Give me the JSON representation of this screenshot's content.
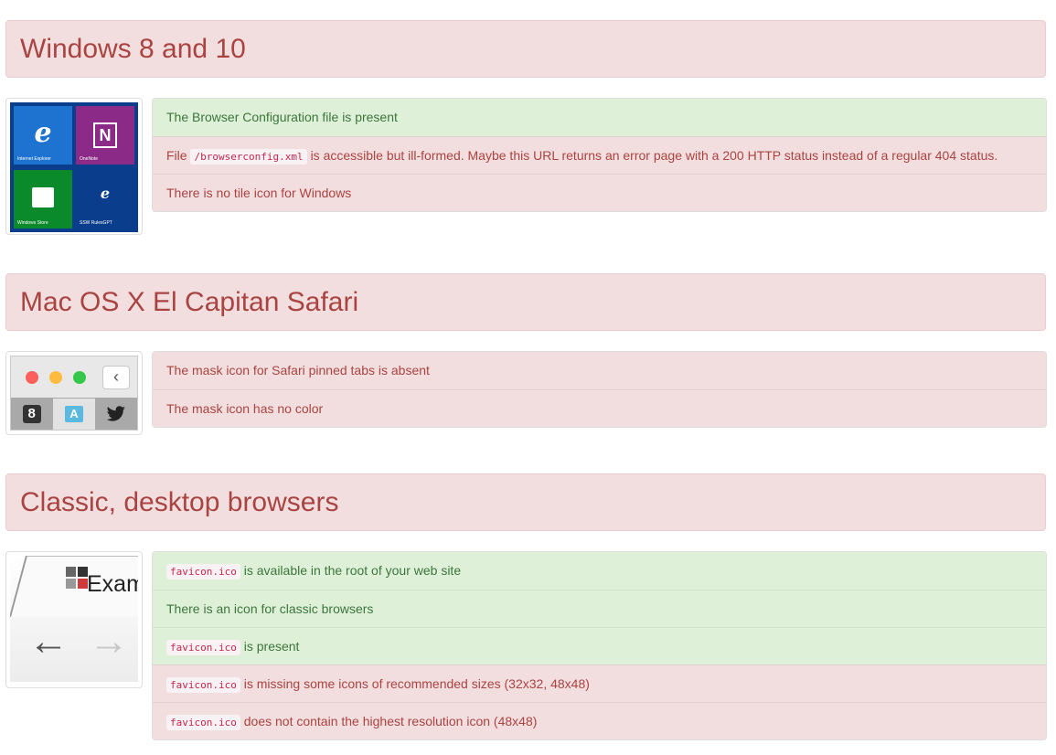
{
  "sections": [
    {
      "title": "Windows 8 and 10",
      "tiles": [
        {
          "caption": "Internet Explorer",
          "color": "#1e73d0",
          "icon": "ie-logo-icon"
        },
        {
          "caption": "OneNote",
          "color": "#8b2a87",
          "icon": "onenote-icon"
        },
        {
          "caption": "Windows Store",
          "color": "#0a8a2a",
          "icon": "store-bag-icon"
        },
        {
          "caption": "SSW RulesGPT",
          "color": "#0a3d8c",
          "icon": "ie-small-icon"
        }
      ],
      "results": [
        {
          "status": "ok",
          "text": "The Browser Configuration file is present"
        },
        {
          "status": "bad",
          "pre": "File",
          "code": "/browserconfig.xml",
          "post": "is accessible but ill-formed. Maybe this URL returns an error page with a 200 HTTP status instead of a regular 404 status."
        },
        {
          "status": "bad",
          "text": "There is no tile icon for Windows"
        }
      ]
    },
    {
      "title": "Mac OS X El Capitan Safari",
      "safari": {
        "traffic_lights": [
          "#fc605c",
          "#fdbc40",
          "#34c84a"
        ],
        "back_glyph": "‹",
        "tab_icons": [
          "google-icon",
          "a-letter-icon",
          "twitter-bird-icon"
        ],
        "tab_a_letter": "A",
        "tab_g_letter": "8"
      },
      "results": [
        {
          "status": "bad",
          "text": "The mask icon for Safari pinned tabs is absent"
        },
        {
          "status": "bad",
          "text": "The mask icon has no color"
        }
      ]
    },
    {
      "title": "Classic, desktop browsers",
      "classic": {
        "tab_text": "Exam",
        "back_arrow": "←",
        "forward_arrow": "→"
      },
      "results": [
        {
          "status": "ok",
          "code": "favicon.ico",
          "post": "is available in the root of your web site"
        },
        {
          "status": "ok",
          "text": "There is an icon for classic browsers"
        },
        {
          "status": "ok",
          "code": "favicon.ico",
          "post": "is present"
        },
        {
          "status": "bad",
          "code": "favicon.ico",
          "post": "is missing some icons of recommended sizes (32x32, 48x48)"
        },
        {
          "status": "bad",
          "code": "favicon.ico",
          "post": "does not contain the highest resolution icon (48x48)"
        }
      ]
    }
  ],
  "colors": {
    "ok_bg": "#dff0d8",
    "ok_text": "#3c763d",
    "bad_bg": "#f2dede",
    "bad_text": "#a94442"
  }
}
